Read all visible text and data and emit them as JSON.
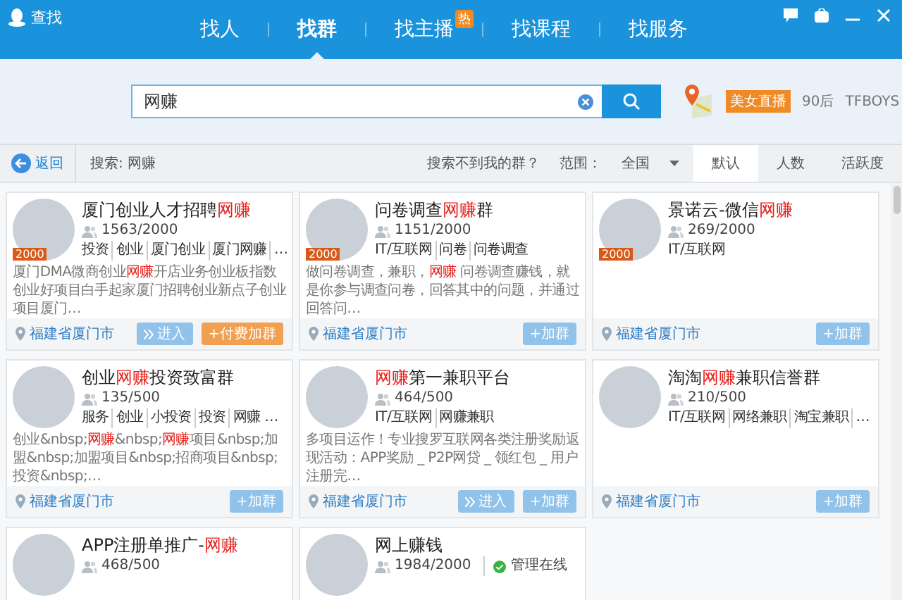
{
  "window": {
    "title": "查找"
  },
  "tabs": [
    {
      "label": "找人",
      "selected": false
    },
    {
      "label": "找群",
      "selected": true
    },
    {
      "label": "找主播",
      "selected": false,
      "badge": "热"
    },
    {
      "label": "找课程",
      "selected": false
    },
    {
      "label": "找服务",
      "selected": false
    }
  ],
  "search": {
    "value": "网赚",
    "hot_tag": "美女直播",
    "quick_links": [
      "90后",
      "TFBOYS"
    ]
  },
  "filter_bar": {
    "back": "返回",
    "query": "搜索: 网赚",
    "not_found": "搜索不到我的群？",
    "scope_label": "范围：",
    "scope": "全国",
    "sort_tabs": [
      {
        "label": "默认",
        "selected": true
      },
      {
        "label": "人数",
        "selected": false
      },
      {
        "label": "活跃度",
        "selected": false
      }
    ]
  },
  "groups": [
    {
      "title": [
        {
          "text": "厦门创业人才招聘",
          "highlight": false
        },
        {
          "text": "网赚",
          "highlight": true
        }
      ],
      "badge": "2000",
      "members": "1563/2000",
      "tags": [
        "投资",
        "创业",
        "厦门创业",
        "厦门网赚",
        "…"
      ],
      "description": [
        {
          "text": "厦门DMA微商创业",
          "highlight": false
        },
        {
          "text": "网赚",
          "highlight": true
        },
        {
          "text": "开店业务创业板指数创业好项目白手起家厦门招聘创业新点子创业项目厦门…",
          "highlight": false
        }
      ],
      "location": "福建省厦门市",
      "buttons": [
        {
          "kind": "enter",
          "label": "进入"
        },
        {
          "kind": "paid",
          "label": "+付费加群"
        }
      ]
    },
    {
      "title": [
        {
          "text": "问卷调查",
          "highlight": false
        },
        {
          "text": "网赚",
          "highlight": true
        },
        {
          "text": "群",
          "highlight": false
        }
      ],
      "badge": "2000",
      "members": "1151/2000",
      "tags": [
        "IT/互联网",
        "问卷",
        "问卷调查"
      ],
      "description": [
        {
          "text": "做问卷调查，兼职，",
          "highlight": false
        },
        {
          "text": "网赚",
          "highlight": true
        },
        {
          "text": " 问卷调查赚钱，就是你参与调查问卷，回答其中的问题，并通过回答问…",
          "highlight": false
        }
      ],
      "location": "福建省厦门市",
      "buttons": [
        {
          "kind": "join",
          "label": "+加群"
        }
      ]
    },
    {
      "title": [
        {
          "text": "景诺云-微信",
          "highlight": false
        },
        {
          "text": "网赚",
          "highlight": true
        }
      ],
      "badge": "2000",
      "members": "269/2000",
      "tags": [
        "IT/互联网"
      ],
      "location": "福建省厦门市",
      "buttons": [
        {
          "kind": "join",
          "label": "+加群"
        }
      ]
    },
    {
      "title": [
        {
          "text": "创业",
          "highlight": false
        },
        {
          "text": "网赚",
          "highlight": true
        },
        {
          "text": "投资致富群",
          "highlight": false
        }
      ],
      "members": "135/500",
      "tags": [
        "服务",
        "创业",
        "小投资",
        "投资",
        "网赚 …"
      ],
      "description": [
        {
          "text": "创业&nbsp;",
          "highlight": false
        },
        {
          "text": "网赚",
          "highlight": true
        },
        {
          "text": "&nbsp;",
          "highlight": false
        },
        {
          "text": "网赚",
          "highlight": true
        },
        {
          "text": "项目&nbsp;加盟&nbsp;加盟项目&nbsp;招商项目&nbsp;投资&nbsp;…",
          "highlight": false
        }
      ],
      "location": "福建省厦门市",
      "buttons": [
        {
          "kind": "join",
          "label": "+加群"
        }
      ]
    },
    {
      "title": [
        {
          "text": "网赚",
          "highlight": true
        },
        {
          "text": "第一兼职平台",
          "highlight": false
        }
      ],
      "members": "464/500",
      "tags": [
        "IT/互联网",
        "网赚兼职"
      ],
      "description": [
        {
          "text": "多项目运作！专业搜罗互联网各类注册奖励返现活动：APP奖励 _ P2P网贷 _ 领红包 _ 用户注册完…",
          "highlight": false
        }
      ],
      "location": "福建省厦门市",
      "buttons": [
        {
          "kind": "enter",
          "label": "进入"
        },
        {
          "kind": "join",
          "label": "+加群"
        }
      ]
    },
    {
      "title": [
        {
          "text": "淘淘",
          "highlight": false
        },
        {
          "text": "网赚",
          "highlight": true
        },
        {
          "text": "兼职信誉群",
          "highlight": false
        }
      ],
      "members": "210/500",
      "tags": [
        "IT/互联网",
        "网络兼职",
        "淘宝兼职",
        "…"
      ],
      "location": "福建省厦门市",
      "buttons": [
        {
          "kind": "join",
          "label": "+加群"
        }
      ]
    },
    {
      "title": [
        {
          "text": "APP注册单推广-",
          "highlight": false
        },
        {
          "text": "网赚",
          "highlight": true
        }
      ],
      "members": "468/500"
    },
    {
      "title": [
        {
          "text": "网上赚钱",
          "highlight": false
        }
      ],
      "members": "1984/2000",
      "admin_online": "管理在线"
    }
  ]
}
